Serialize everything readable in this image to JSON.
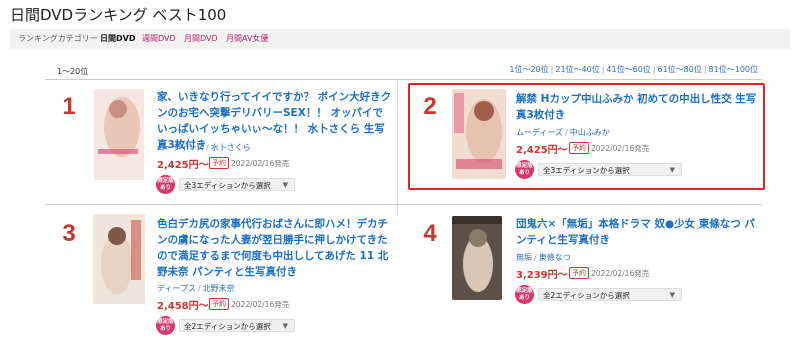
{
  "page": {
    "title": "日間DVDランキング ベスト100"
  },
  "category_bar": {
    "label": "ランキングカテゴリー",
    "active": "日間DVD",
    "links": [
      "週間DVD",
      "月間DVD",
      "月間AV女優"
    ]
  },
  "range": {
    "current": "1〜20位",
    "pages": [
      "1位〜20位",
      "21位〜40位",
      "41位〜60位",
      "61位〜80位",
      "81位〜100位"
    ],
    "separator": "|"
  },
  "items": [
    {
      "rank": "1",
      "title": "家、いきなり行ってイイですか？ ボイン大好きクンのお宅へ突撃デリバリーSEX！！ オッパイでいっぱいイッちゃいぃ〜な！！ 水卜さくら 生写真3枚付き",
      "maker": "ムーディーズ",
      "actress": "水卜さくら",
      "price": "2,425円〜",
      "badge": "予約",
      "date": "2022/02/16発売",
      "limited": "限定版あり",
      "select": "全3エディションから選択",
      "thumb_colors": [
        "#e9c6b6",
        "#c98f84",
        "#f6e7e2"
      ]
    },
    {
      "rank": "2",
      "title": "解禁 Hカップ中山ふみか 初めての中出し性交 生写真3枚付き",
      "maker": "ムーディーズ",
      "actress": "中山ふみか",
      "price": "2,425円〜",
      "badge": "予約",
      "date": "2022/02/16発売",
      "limited": "限定版あり",
      "select": "全3エディションから選択",
      "thumb_colors": [
        "#e5c3b0",
        "#a25e4a",
        "#f1dcd0"
      ]
    },
    {
      "rank": "3",
      "title": "色白デカ尻の家事代行おばさんに即ハメ！デカチンの虜になった人妻が翌日勝手に押しかけてきたので満足するまで何度も中出ししてあげた 11 北野未奈 パンティと生写真付き",
      "maker": "ディープス",
      "actress": "北野未奈",
      "price": "2,458円〜",
      "badge": "予約",
      "date": "2022/02/16発売",
      "limited": "限定版あり",
      "select": "全2エディションから選択",
      "thumb_colors": [
        "#e8d2c2",
        "#7b5a4a",
        "#efe5dc"
      ]
    },
    {
      "rank": "4",
      "title": "団鬼六×「無垢」本格ドラマ 奴●少女 東條なつ パンティと生写真付き",
      "maker": "無垢",
      "actress": "東條なつ",
      "price": "3,239円〜",
      "badge": "予約",
      "date": "2022/02/16発売",
      "limited": "限定版あり",
      "select": "全2エディションから選択",
      "thumb_colors": [
        "#5d5048",
        "#d9c6b4",
        "#8a7a6c"
      ]
    }
  ]
}
